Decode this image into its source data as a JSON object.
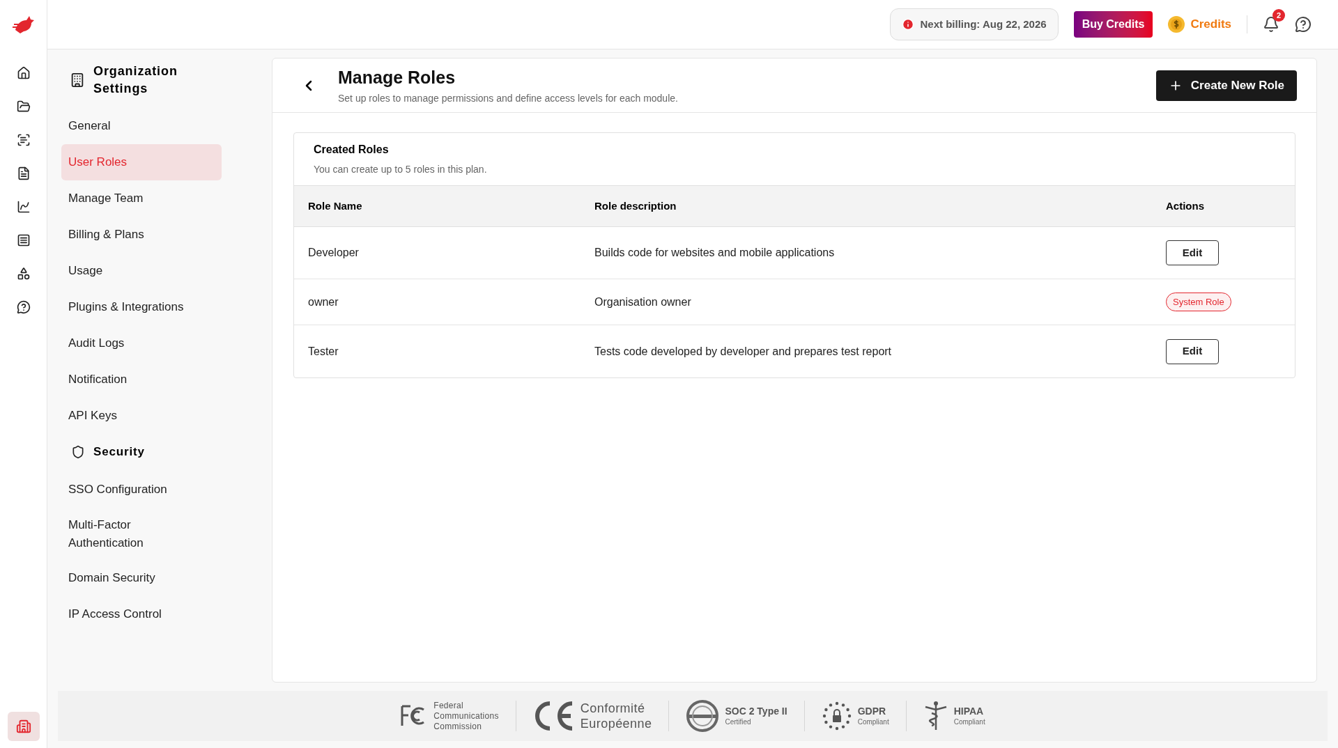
{
  "top_bar": {
    "billing": "Next billing: Aug 22, 2026",
    "buy_button": "Buy Credits",
    "credits": "Credits",
    "notification_count": "2"
  },
  "rail": {
    "items": [
      {
        "kind": "home",
        "selected": false
      },
      {
        "kind": "folder",
        "selected": false
      },
      {
        "kind": "scan",
        "selected": false
      },
      {
        "kind": "doc",
        "selected": false
      },
      {
        "kind": "chart",
        "selected": false
      },
      {
        "kind": "list",
        "selected": false
      },
      {
        "kind": "shapes",
        "selected": false
      },
      {
        "kind": "help",
        "selected": false
      }
    ],
    "bottom": {
      "selected": true
    }
  },
  "sidebar": {
    "title": "Organization Settings",
    "items": [
      {
        "label": "General",
        "selected": false
      },
      {
        "label": "User Roles",
        "selected": true
      },
      {
        "label": "Manage Team",
        "selected": false
      },
      {
        "label": "Billing & Plans",
        "selected": false
      },
      {
        "label": "Usage",
        "selected": false
      },
      {
        "label": "Plugins & Integrations",
        "selected": false
      },
      {
        "label": "Audit Logs",
        "selected": false
      },
      {
        "label": "Notification",
        "selected": false
      },
      {
        "label": "API Keys",
        "selected": false
      }
    ],
    "security": {
      "title": "Security",
      "items": [
        {
          "label": "SSO Configuration",
          "selected": false
        },
        {
          "label": "Multi-Factor Authentication",
          "selected": false
        },
        {
          "label": "Domain Security",
          "selected": false
        },
        {
          "label": "IP Access Control",
          "selected": false
        }
      ]
    }
  },
  "page": {
    "title": "Manage Roles",
    "subtitle": "Set up roles to manage permissions and define access levels for each module.",
    "create_button": "Create New Role"
  },
  "roles": {
    "title": "Created Roles",
    "subtitle": "You can create up to 5 roles in this plan.",
    "columns": [
      "Role Name",
      "Role description",
      "Actions"
    ],
    "rows": [
      {
        "name": "Developer",
        "description": "Builds code for websites and mobile applications",
        "action": {
          "kind": "button",
          "label": "Edit"
        }
      },
      {
        "name": "owner",
        "description": "Organisation owner",
        "action": {
          "kind": "badge",
          "label": "System Role"
        }
      },
      {
        "name": "Tester",
        "description": "Tests code developed by developer and prepares test report",
        "action": {
          "kind": "button",
          "label": "Edit"
        }
      }
    ]
  },
  "footer": [
    {
      "kind": "fcc",
      "lines": [
        "Federal",
        "Communications",
        "Commission"
      ]
    },
    {
      "kind": "ce",
      "lines": [
        "Conformité",
        "Européenne"
      ]
    },
    {
      "kind": "soc",
      "lines": [
        "SOC 2 Type II",
        "Certified"
      ]
    },
    {
      "kind": "gdpr",
      "lines": [
        "GDPR",
        "Compliant"
      ]
    },
    {
      "kind": "hipaa",
      "lines": [
        "HIPAA",
        "Compliant"
      ]
    }
  ]
}
